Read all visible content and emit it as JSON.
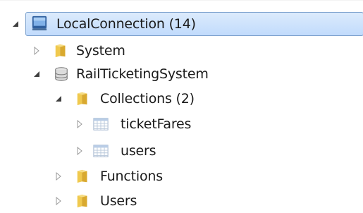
{
  "tree": {
    "root": {
      "label": "LocalConnection (14)",
      "icon": "computer-icon",
      "expanded": true,
      "selected": true
    },
    "system": {
      "label": "System",
      "icon": "folder-icon",
      "expanded": false
    },
    "database": {
      "label": "RailTicketingSystem",
      "icon": "database-icon",
      "expanded": true
    },
    "collections": {
      "label": "Collections (2)",
      "icon": "folder-icon",
      "expanded": true
    },
    "ticketFares": {
      "label": "ticketFares",
      "icon": "table-icon",
      "expanded": false
    },
    "users_collection": {
      "label": "users",
      "icon": "table-icon",
      "expanded": false
    },
    "functions": {
      "label": "Functions",
      "icon": "folder-icon",
      "expanded": false
    },
    "users_folder": {
      "label": "Users",
      "icon": "folder-icon",
      "expanded": false
    }
  },
  "colors": {
    "selection_border": "#7da2ce",
    "selection_fill": "#c9e0fc",
    "folder": "#e8c252",
    "expander": "#8c8c8c"
  }
}
